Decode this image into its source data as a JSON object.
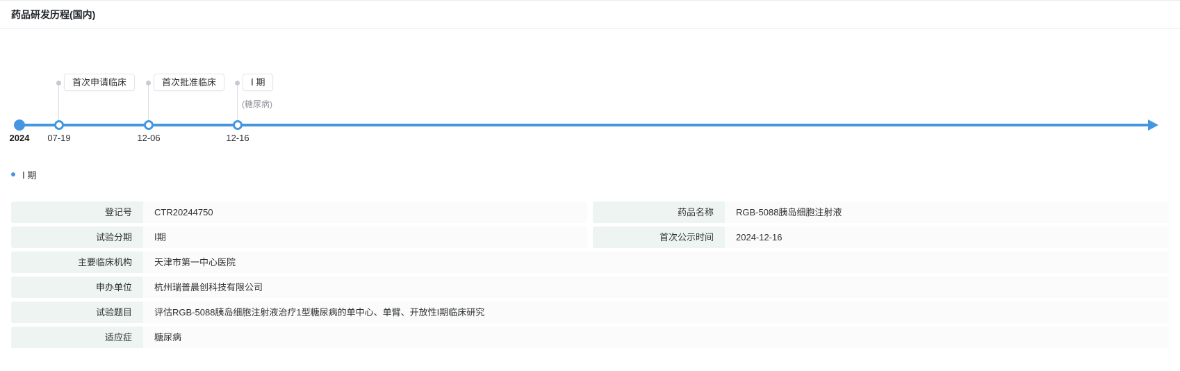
{
  "colors": {
    "accent": "#4596e0",
    "label-bg": "#edf4f2",
    "value-bg": "#fafbfa",
    "border": "#e8eaec",
    "muted": "#909399",
    "stem": "#d8dce2",
    "text": "#303133"
  },
  "header": {
    "title": "药品研发历程(国内)"
  },
  "timeline": {
    "start_year": "2024",
    "milestones": [
      {
        "date": "07-19",
        "label": "首次申请临床",
        "sub": ""
      },
      {
        "date": "12-06",
        "label": "首次批准临床",
        "sub": ""
      },
      {
        "date": "12-16",
        "label": "Ⅰ 期",
        "sub": "(糖尿病)"
      }
    ]
  },
  "phase_section": {
    "bullet_label": "Ⅰ 期"
  },
  "detail": {
    "rows": [
      {
        "label": "登记号",
        "value": "CTR20244750"
      },
      {
        "label": "药品名称",
        "value": "RGB-5088胰岛细胞注射液"
      },
      {
        "label": "试验分期",
        "value": "Ⅰ期"
      },
      {
        "label": "首次公示时间",
        "value": "2024-12-16"
      },
      {
        "label": "主要临床机构",
        "value": "天津市第一中心医院"
      },
      {
        "label": "申办单位",
        "value": "杭州瑞普晨创科技有限公司"
      },
      {
        "label": "试验题目",
        "value": "评估RGB-5088胰岛细胞注射液治疗1型糖尿病的单中心、单臂、开放性I期临床研究"
      },
      {
        "label": "适应症",
        "value": "糖尿病"
      }
    ]
  }
}
